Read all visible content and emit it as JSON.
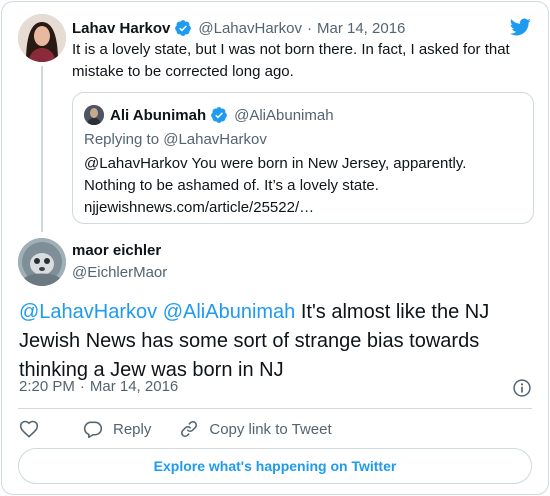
{
  "parent": {
    "name": "Lahav Harkov",
    "handle": "@LahavHarkov",
    "separator": "·",
    "date": "Mar 14, 2016",
    "text": "It is a lovely state, but I was not born there. In fact, I asked for that mistake to be corrected long ago."
  },
  "quoted": {
    "name": "Ali Abunimah",
    "handle": "@AliAbunimah",
    "replying_to": "Replying to @LahavHarkov",
    "line1": "@LahavHarkov You were born in New Jersey, apparently.",
    "line2": "Nothing to be ashamed of. It’s a lovely state.",
    "line3": "njjewishnews.com/article/25522/…"
  },
  "main": {
    "name": "maor eichler",
    "handle": "@EichlerMaor",
    "mention1": "@LahavHarkov",
    "mention2": "@AliAbunimah",
    "text": " It's almost like the NJ Jewish News has some sort of strange bias towards thinking a Jew was born in NJ",
    "time": "2:20 PM",
    "separator": "·",
    "date": "Mar 14, 2016"
  },
  "actions": {
    "reply_label": "Reply",
    "copy_label": "Copy link to Tweet"
  },
  "footer": {
    "explore_label": "Explore what's happening on Twitter"
  },
  "colors": {
    "accent": "#1d9bf0",
    "text": "#0f1419",
    "muted": "#536471",
    "border": "#cfd9de"
  },
  "icons": [
    "verified-badge-icon",
    "twitter-logo-icon",
    "info-icon",
    "heart-icon",
    "reply-icon",
    "link-icon"
  ]
}
